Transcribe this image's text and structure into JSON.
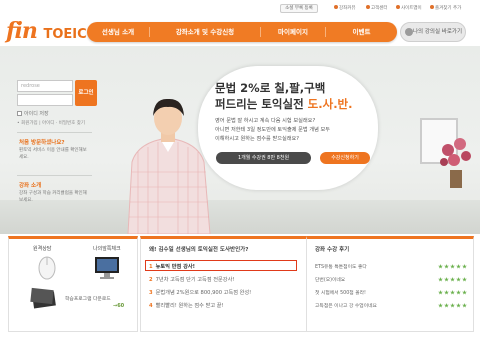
{
  "top_utility": {
    "button": "소셜 부록 등록",
    "links": [
      "강좌커뮤",
      "고객센터",
      "사이트맵이",
      "즐겨찾기 추가"
    ]
  },
  "logo": {
    "fin": "fin",
    "toeic": "TOEIC"
  },
  "nav": {
    "items": [
      "선생님 소개",
      "강좌소개 및 수강신청",
      "마이페이지",
      "이벤트"
    ],
    "my_class": "나의 강의실 바로가기"
  },
  "login": {
    "id_placeholder": "redrose",
    "pw_placeholder": "",
    "button": "로그인",
    "save_id": "아이디 저장",
    "links": "• 회원가입 | 아이디 · 비밀번호 찾기"
  },
  "sidebar": {
    "guide_title": "처음 방문하셨나요?",
    "guide_text": "핀토익 서비스 이용 안내를 확인해보세요.",
    "lecture_title": "강좌 소개",
    "lecture_text": "강좌 구성과 학습 커리큘럼을 확인해 보세요."
  },
  "hero": {
    "headline1": "문법 2%로 칠,팔,구백",
    "headline2_prefix": "퍼드리는 토익실전",
    "headline2_highlight": " 도.사.반.",
    "body": [
      "영어 문법 잘 하시고 계속 다음 시험 보실래요?",
      "아니면 저한테 3일 정도만에 토익출제 문법 개념 모두",
      "이해하시고 원하는 점수를 받으실래요?"
    ],
    "cta_price": "1개월 수강권 8만 8천원",
    "cta_apply": "수강신청하기"
  },
  "bottom_left": {
    "remote_label": "원격상담",
    "pc_label": "나의앞쪽체크",
    "download_label": "학습프로그램 다운로드",
    "download_count": "→60"
  },
  "bottom_mid": {
    "title": "왜! 김수일 선생님의 토익실전 도사반인가?",
    "items": [
      {
        "num": "1",
        "text": "뉴토익 만점 강사!"
      },
      {
        "num": "2",
        "text": "7년차 고득점 단기 고득점 전문강사!"
      },
      {
        "num": "3",
        "text": "문법개념 2%원으로 800,900 고득점 완성!"
      },
      {
        "num": "4",
        "text": "빨리빨리! 원하는 점수 받고 끝!"
      }
    ]
  },
  "bottom_right": {
    "title": "강좌 수강 후기",
    "reviews": [
      "ETS유통 특툰점이도 좋다",
      "단번(오)이네요",
      "첫 시험에서 500점 올라!",
      "고득점은 이나고 강 수업이네요"
    ],
    "star_rating_out_of_5": [
      5,
      5,
      5,
      5,
      5
    ]
  },
  "colors": {
    "accent": "#ee7420",
    "highlight_box": "#e03a1a",
    "star": "#6ab04c"
  }
}
